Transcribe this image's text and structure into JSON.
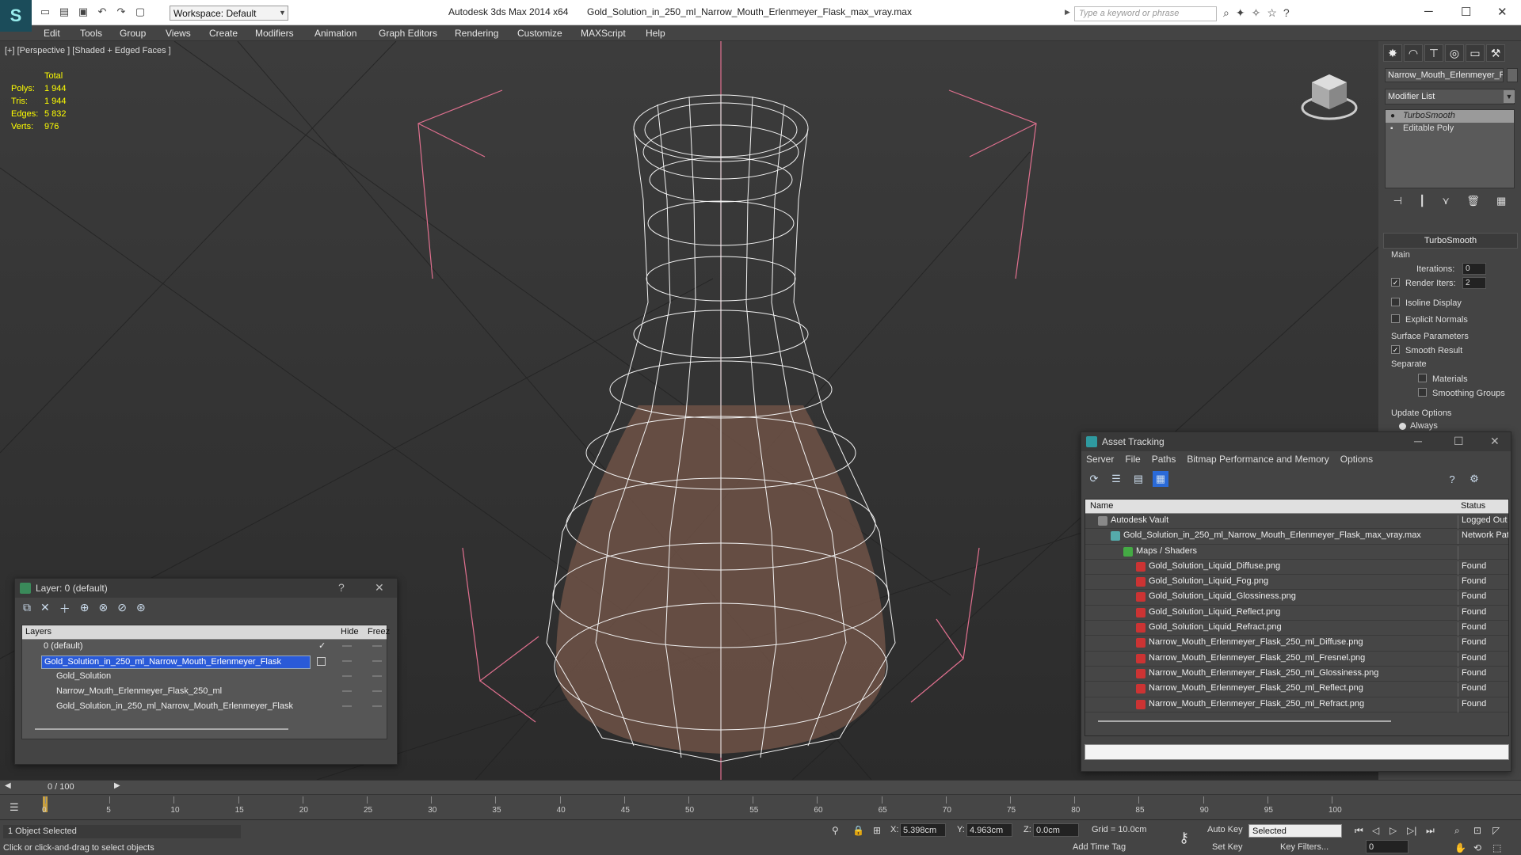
{
  "app": {
    "title": "Autodesk 3ds Max  2014 x64",
    "file": "Gold_Solution_in_250_ml_Narrow_Mouth_Erlenmeyer_Flask_max_vray.max",
    "workspace": "Workspace: Default",
    "search_placeholder": "Type a keyword or phrase",
    "logo": "S"
  },
  "menu": [
    "Edit",
    "Tools",
    "Group",
    "Views",
    "Create",
    "Modifiers",
    "Animation",
    "Graph Editors",
    "Rendering",
    "Customize",
    "MAXScript",
    "Help"
  ],
  "viewport": {
    "label": "[+] [Perspective ] [Shaded + Edged Faces ]",
    "stats": {
      "header": "Total",
      "rows": [
        {
          "k": "Polys:",
          "v": "1 944"
        },
        {
          "k": "Tris:",
          "v": "1 944"
        },
        {
          "k": "Edges:",
          "v": "5 832"
        },
        {
          "k": "Verts:",
          "v": "976"
        }
      ]
    }
  },
  "command_panel": {
    "object_name": "Narrow_Mouth_Erlenmeyer_F",
    "modifier_list": "Modifier List",
    "stack": [
      "TurboSmooth",
      "Editable Poly"
    ],
    "turbosmooth": {
      "title": "TurboSmooth",
      "main": "Main",
      "iterations_label": "Iterations:",
      "iterations": "0",
      "render_iters_label": "Render Iters:",
      "render_iters": "2",
      "isoline": "Isoline Display",
      "explicit": "Explicit Normals",
      "surface": "Surface Parameters",
      "smooth": "Smooth Result",
      "separate": "Separate",
      "materials": "Materials",
      "smoothing": "Smoothing Groups",
      "update": "Update Options",
      "always": "Always"
    }
  },
  "layer_window": {
    "title": "Layer: 0 (default)",
    "help": "?",
    "col_layers": "Layers",
    "col_hide": "Hide",
    "col_freeze": "Freez",
    "rows": [
      {
        "label": "0 (default)",
        "indent": 1,
        "selected": false,
        "check": true
      },
      {
        "label": "Gold_Solution_in_250_ml_Narrow_Mouth_Erlenmeyer_Flask",
        "indent": 1,
        "selected": true,
        "check": false
      },
      {
        "label": "Gold_Solution",
        "indent": 2,
        "selected": false,
        "check": false
      },
      {
        "label": "Narrow_Mouth_Erlenmeyer_Flask_250_ml",
        "indent": 2,
        "selected": false,
        "check": false
      },
      {
        "label": "Gold_Solution_in_250_ml_Narrow_Mouth_Erlenmeyer_Flask",
        "indent": 2,
        "selected": false,
        "check": false
      }
    ]
  },
  "asset_tracking": {
    "title": "Asset Tracking",
    "menu": [
      "Server",
      "File",
      "Paths",
      "Bitmap Performance and Memory",
      "Options"
    ],
    "col_name": "Name",
    "col_status": "Status",
    "rows": [
      {
        "name": "Autodesk Vault",
        "status": "Logged Out",
        "indent": 1
      },
      {
        "name": "Gold_Solution_in_250_ml_Narrow_Mouth_Erlenmeyer_Flask_max_vray.max",
        "status": "Network Path",
        "indent": 2
      },
      {
        "name": "Maps / Shaders",
        "status": "",
        "indent": 3
      },
      {
        "name": "Gold_Solution_Liquid_Diffuse.png",
        "status": "Found",
        "indent": 4
      },
      {
        "name": "Gold_Solution_Liquid_Fog.png",
        "status": "Found",
        "indent": 4
      },
      {
        "name": "Gold_Solution_Liquid_Glossiness.png",
        "status": "Found",
        "indent": 4
      },
      {
        "name": "Gold_Solution_Liquid_Reflect.png",
        "status": "Found",
        "indent": 4
      },
      {
        "name": "Gold_Solution_Liquid_Refract.png",
        "status": "Found",
        "indent": 4
      },
      {
        "name": "Narrow_Mouth_Erlenmeyer_Flask_250_ml_Diffuse.png",
        "status": "Found",
        "indent": 4
      },
      {
        "name": "Narrow_Mouth_Erlenmeyer_Flask_250_ml_Fresnel.png",
        "status": "Found",
        "indent": 4
      },
      {
        "name": "Narrow_Mouth_Erlenmeyer_Flask_250_ml_Glossiness.png",
        "status": "Found",
        "indent": 4
      },
      {
        "name": "Narrow_Mouth_Erlenmeyer_Flask_250_ml_Reflect.png",
        "status": "Found",
        "indent": 4
      },
      {
        "name": "Narrow_Mouth_Erlenmeyer_Flask_250_ml_Refract.png",
        "status": "Found",
        "indent": 4
      }
    ]
  },
  "timeline": {
    "frame": "0 / 100",
    "ticks": [
      "0",
      "5",
      "10",
      "15",
      "20",
      "25",
      "30",
      "35",
      "40",
      "45",
      "50",
      "55",
      "60",
      "65",
      "70",
      "75",
      "80",
      "85",
      "90",
      "95",
      "100"
    ]
  },
  "status": {
    "selected": "1 Object Selected",
    "hint": "Click or click-and-drag to select objects",
    "x_label": "X:",
    "x": "5.398cm",
    "y_label": "Y:",
    "y": "4.963cm",
    "z_label": "Z:",
    "z": "0.0cm",
    "grid": "Grid = 10.0cm",
    "auto_key": "Auto Key",
    "key_mode": "Selected",
    "set_key": "Set Key",
    "key_filters": "Key Filters...",
    "add_time_tag": "Add Time Tag",
    "frame_field": "0"
  }
}
